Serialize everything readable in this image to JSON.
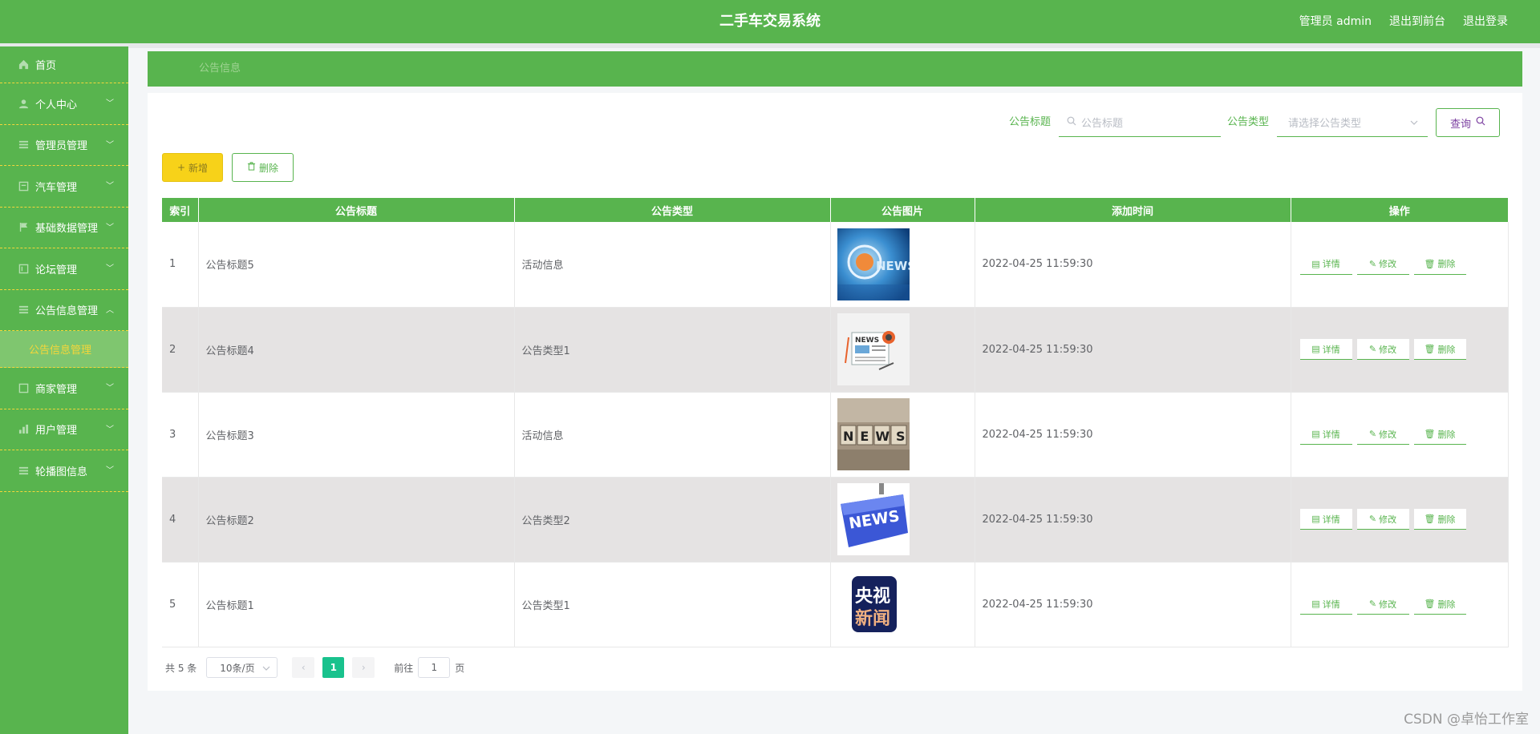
{
  "header": {
    "title": "二手车交易系统",
    "admin_label": "管理员 admin",
    "back_front": "退出到前台",
    "logout": "退出登录"
  },
  "sidebar": {
    "items": [
      {
        "label": "首页",
        "icon": "home-icon"
      },
      {
        "label": "个人中心",
        "icon": "user-icon"
      },
      {
        "label": "管理员管理",
        "icon": "list-icon"
      },
      {
        "label": "汽车管理",
        "icon": "box-icon"
      },
      {
        "label": "基础数据管理",
        "icon": "flag-icon"
      },
      {
        "label": "论坛管理",
        "icon": "chat-icon"
      },
      {
        "label": "公告信息管理",
        "icon": "list-icon"
      },
      {
        "label": "商家管理",
        "icon": "box-icon"
      },
      {
        "label": "用户管理",
        "icon": "chart-icon"
      },
      {
        "label": "轮播图信息",
        "icon": "list-icon"
      }
    ],
    "active_sub": "公告信息管理"
  },
  "breadcrumb": "公告信息",
  "search": {
    "title_label": "公告标题",
    "title_placeholder": "公告标题",
    "type_label": "公告类型",
    "type_placeholder": "请选择公告类型",
    "query_button": "查询"
  },
  "toolbar": {
    "add": "新增",
    "delete": "删除"
  },
  "table": {
    "headers": [
      "索引",
      "公告标题",
      "公告类型",
      "公告图片",
      "添加时间",
      "操作"
    ],
    "rows": [
      {
        "index": "1",
        "title": "公告标题5",
        "type": "活动信息",
        "time": "2022-04-25 11:59:30",
        "image": "news-globe"
      },
      {
        "index": "2",
        "title": "公告标题4",
        "type": "公告类型1",
        "time": "2022-04-25 11:59:30",
        "image": "news-paper"
      },
      {
        "index": "3",
        "title": "公告标题3",
        "type": "活动信息",
        "time": "2022-04-25 11:59:30",
        "image": "news-blocks"
      },
      {
        "index": "4",
        "title": "公告标题2",
        "type": "公告类型2",
        "time": "2022-04-25 11:59:30",
        "image": "news-key"
      },
      {
        "index": "5",
        "title": "公告标题1",
        "type": "公告类型1",
        "time": "2022-04-25 11:59:30",
        "image": "cctv-news"
      }
    ],
    "ops": {
      "detail": "详情",
      "edit": "修改",
      "delete": "删除"
    }
  },
  "pagination": {
    "total": "共 5 条",
    "page_size": "10条/页",
    "current": "1",
    "goto_prefix": "前往",
    "goto_value": "1",
    "goto_suffix": "页"
  },
  "images": {
    "news_text": "NEWS",
    "cctv_line1": "央视",
    "cctv_line2": "新闻"
  },
  "watermark": "CSDN @卓怡工作室",
  "colors": {
    "primary": "#58b44e",
    "accent": "#f4d63a",
    "add_button": "#f7d219",
    "page_active": "#19c28d"
  }
}
